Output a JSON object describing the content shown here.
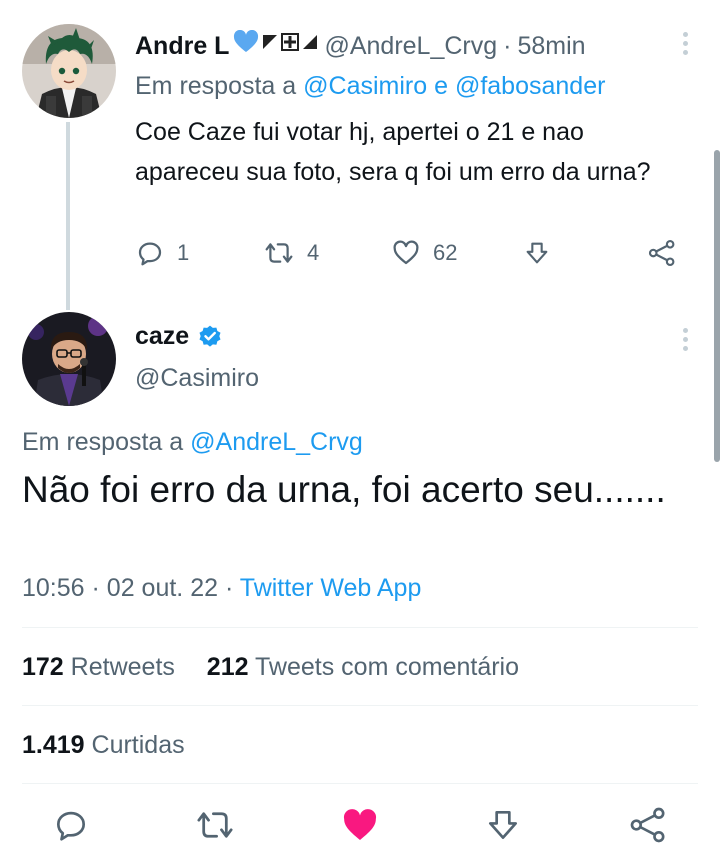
{
  "colors": {
    "accent": "#1d9bf0",
    "secondary_text": "#536471",
    "like_active": "#f91880"
  },
  "tweet1": {
    "author_name": "Andre L",
    "name_emoji": [
      "blue-heart-icon",
      "flag-icon",
      "cross-flag-icon",
      "triangle-flag-icon"
    ],
    "handle": "@AndreL_Crvg",
    "separator": "·",
    "time": "58min",
    "reply_prefix": "Em resposta a",
    "reply_user1": "@Casimiro",
    "reply_and": "e",
    "reply_user2": "@fabosander",
    "text": "Coe Caze fui votar hj, apertei o 21 e nao apareceu sua foto, sera q foi um erro da urna?",
    "actions": {
      "replies": "1",
      "retweets": "4",
      "likes": "62"
    }
  },
  "tweet2": {
    "author_name": "caze",
    "verified": true,
    "handle": "@Casimiro",
    "reply_prefix": "Em resposta a",
    "reply_user": "@AndreL_Crvg",
    "text": "Não foi erro da urna, foi acerto seu.......",
    "time": "10:56",
    "sep1": "·",
    "date": "02 out. 22",
    "sep2": "·",
    "source": "Twitter Web App",
    "stats": {
      "retweets_count": "172",
      "retweets_label": "Retweets",
      "quotes_count": "212",
      "quotes_label": "Tweets com comentário",
      "likes_count": "1.419",
      "likes_label": "Curtidas"
    },
    "liked": true
  }
}
